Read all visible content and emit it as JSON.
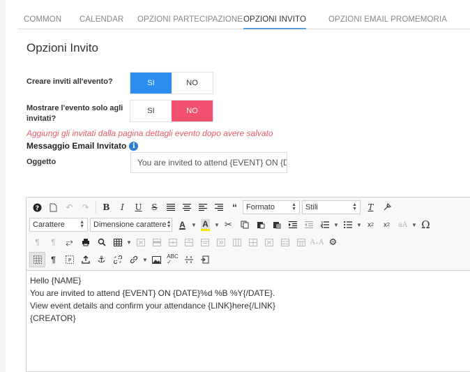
{
  "tabs": [
    {
      "label": "COMMON",
      "active": false
    },
    {
      "label": "CALENDAR",
      "active": false
    },
    {
      "label": "OPZIONI PARTECIPAZIONE",
      "active": false
    },
    {
      "label": "OPZIONI INVITO",
      "active": true
    },
    {
      "label": "OPZIONI EMAIL PROMEMORIA",
      "active": false
    }
  ],
  "page_title": "Opzioni Invito",
  "create_invites": {
    "label": "Creare inviti all'evento?",
    "yes": "SI",
    "no": "NO",
    "selected": "SI"
  },
  "show_only_invited": {
    "label": "Mostrare l'evento solo agli invitati?",
    "yes": "SI",
    "no": "NO",
    "selected": "NO"
  },
  "hint": "Aggiungi gli invitati dalla pagina dettagli evento dopo avere salvato",
  "email_section": {
    "title": "Messaggio Email Invitato",
    "info_icon": "i"
  },
  "subject": {
    "label": "Oggetto",
    "value": "You are invited to attend {EVENT} ON {DATE}"
  },
  "toolbar": {
    "format_label": "Formato",
    "styles_label": "Stili",
    "font_label": "Carattere",
    "size_label": "Dimensione carattere"
  },
  "body_lines": [
    "Hello {NAME}",
    "You are invited to attend {EVENT} ON {DATE}%d %B %Y{/DATE}.",
    "View event details and confirm your attendance {LINK}here{/LINK}",
    "{CREATOR}"
  ],
  "colors": {
    "accent_blue": "#2a8ef0",
    "accent_red": "#f2526e",
    "hint_red": "#e85a6f",
    "tab_underline": "#5b9bd5"
  }
}
